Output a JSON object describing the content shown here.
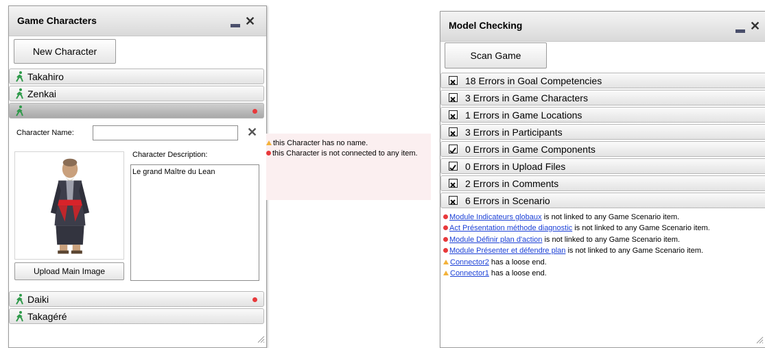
{
  "characters_panel": {
    "title": "Game Characters",
    "new_button": "New Character",
    "characters": [
      {
        "name": "Takahiro",
        "error": false
      },
      {
        "name": "Zenkai",
        "error": false
      },
      {
        "name": "",
        "error": true,
        "selected": true
      },
      {
        "name": "Daiki",
        "error": true
      },
      {
        "name": "Takagéré",
        "error": false
      }
    ],
    "editor": {
      "name_label": "Character Name:",
      "name_value": "",
      "description_label": "Character Description:",
      "description_value": "Le grand Maître du Lean",
      "upload_button": "Upload Main Image"
    }
  },
  "tooltip": {
    "messages": [
      {
        "icon": "warning",
        "text": "this Character  has no name."
      },
      {
        "icon": "error",
        "text": "this Character  is not connected to any item."
      }
    ]
  },
  "model_panel": {
    "title": "Model Checking",
    "scan_button": "Scan Game",
    "categories": [
      {
        "label": "18 Errors in Goal Competencies",
        "state": "x"
      },
      {
        "label": "3 Errors in Game Characters",
        "state": "x"
      },
      {
        "label": "1 Errors in Game Locations",
        "state": "x"
      },
      {
        "label": "3 Errors in Participants",
        "state": "x"
      },
      {
        "label": "0 Errors in Game Components",
        "state": "check"
      },
      {
        "label": "0 Errors in Upload Files",
        "state": "check"
      },
      {
        "label": "2 Errors in Comments",
        "state": "x"
      },
      {
        "label": "6 Errors in Scenario",
        "state": "x"
      }
    ],
    "details": [
      {
        "icon": "error",
        "link": "Module  Indicateurs globaux",
        "text": " is not linked to any Game Scenario item."
      },
      {
        "icon": "error",
        "link": "Act  Présentation méthode diagnostic",
        "text": " is not linked to any Game Scenario item."
      },
      {
        "icon": "error",
        "link": "Module  Définir plan d'action",
        "text": " is not linked to any Game Scenario item."
      },
      {
        "icon": "error",
        "link": "Module  Présenter et défendre plan",
        "text": " is not linked to any Game Scenario item."
      },
      {
        "icon": "warning",
        "link": "Connector2",
        "text": "  has a loose end."
      },
      {
        "icon": "warning",
        "link": "Connector1",
        "text": "  has a loose end."
      }
    ]
  }
}
